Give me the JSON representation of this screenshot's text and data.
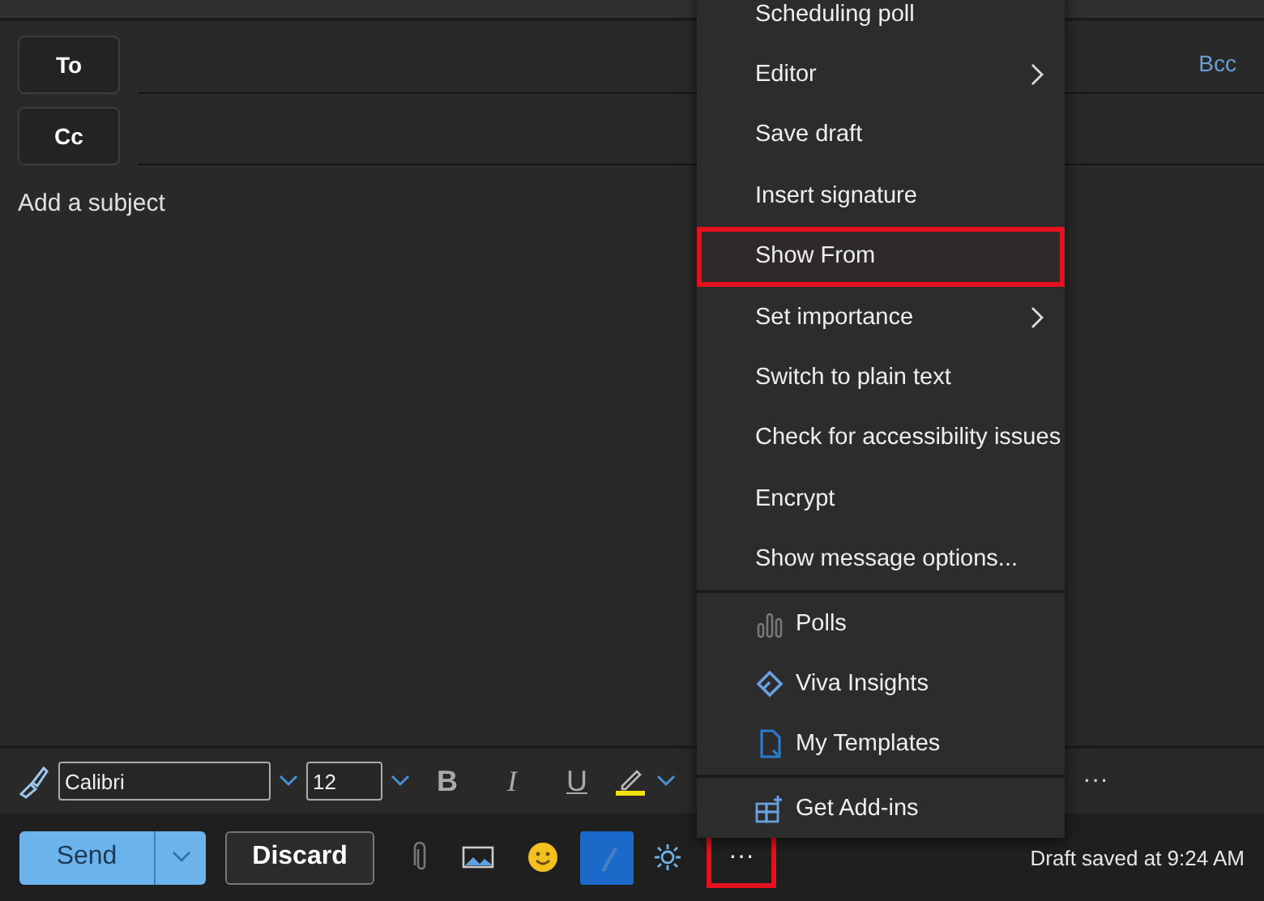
{
  "recipients": [
    {
      "label": "To"
    },
    {
      "label": "Cc"
    }
  ],
  "bcc_link": "Bcc",
  "subject": {
    "placeholder": "Add a subject"
  },
  "format_toolbar": {
    "font": "Calibri",
    "size": "12",
    "bold": "B",
    "italic": "I",
    "underline": "U",
    "more": "···"
  },
  "actions": {
    "send": "Send",
    "discard": "Discard",
    "more": "···",
    "more_highlighted": true
  },
  "status": "Draft saved at 9:24 AM",
  "menu": {
    "sections": [
      {
        "items": [
          {
            "label": "Scheduling poll",
            "kind": "action",
            "highlighted": false
          },
          {
            "label": "Editor",
            "kind": "submenu",
            "highlighted": false
          },
          {
            "label": "Save draft",
            "kind": "action",
            "highlighted": false
          },
          {
            "label": "Insert signature",
            "kind": "action",
            "highlighted": false
          },
          {
            "label": "Show From",
            "kind": "action",
            "highlighted": true
          },
          {
            "label": "Set importance",
            "kind": "submenu",
            "highlighted": false
          },
          {
            "label": "Switch to plain text",
            "kind": "action",
            "highlighted": false
          },
          {
            "label": "Check for accessibility issues",
            "kind": "action",
            "highlighted": false
          },
          {
            "label": "Encrypt",
            "kind": "action",
            "highlighted": false
          },
          {
            "label": "Show message options...",
            "kind": "action",
            "highlighted": false
          }
        ]
      },
      {
        "items": [
          {
            "label": "Polls",
            "kind": "addin",
            "highlighted": false
          },
          {
            "label": "Viva Insights",
            "kind": "addin",
            "highlighted": false
          },
          {
            "label": "My Templates",
            "kind": "addin",
            "highlighted": false
          }
        ]
      },
      {
        "items": [
          {
            "label": "Get Add-ins",
            "kind": "addin",
            "highlighted": false
          }
        ]
      }
    ]
  }
}
